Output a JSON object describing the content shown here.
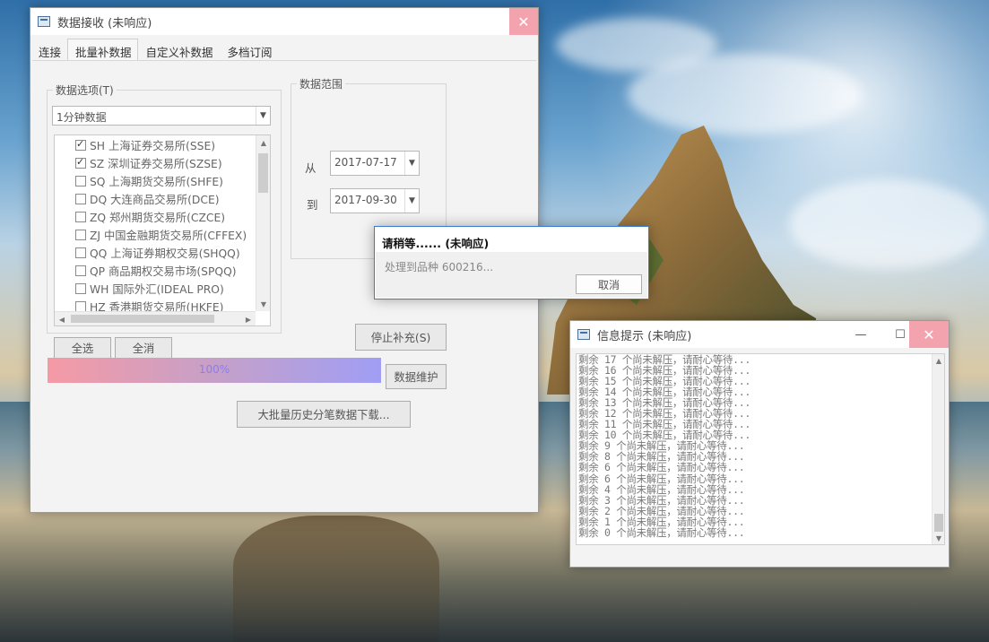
{
  "main_window": {
    "title": "数据接收 (未响应)",
    "close_symbol": "✕",
    "tabs": [
      "连接",
      "批量补数据",
      "自定义补数据",
      "多档订阅"
    ],
    "data_options_label": "数据选项(T)",
    "data_type_selected": "1分钟数据",
    "markets": [
      {
        "label": "SH 上海证券交易所(SSE)",
        "checked": true
      },
      {
        "label": "SZ 深圳证券交易所(SZSE)",
        "checked": true
      },
      {
        "label": "SQ 上海期货交易所(SHFE)",
        "checked": false
      },
      {
        "label": "DQ 大连商品交易所(DCE)",
        "checked": false
      },
      {
        "label": "ZQ 郑州期货交易所(CZCE)",
        "checked": false
      },
      {
        "label": "ZJ 中国金融期货交易所(CFFEX)",
        "checked": false
      },
      {
        "label": "QQ 上海证券期权交易(SHQQ)",
        "checked": false
      },
      {
        "label": "QP 商品期权交易市场(SPQQ)",
        "checked": false
      },
      {
        "label": "WH 国际外汇(IDEAL PRO)",
        "checked": false
      },
      {
        "label": "HZ 香港期货交易所(HKFE)",
        "checked": false
      }
    ],
    "range_label": "数据范围",
    "from_label": "从",
    "from_date": "2017-07-17",
    "to_label": "到",
    "to_date": "2017-09-30",
    "select_all": "全选",
    "select_none": "全消",
    "stop_button": "停止补充(S)",
    "progress_text": "100%",
    "progress_value": 1.0,
    "maintain_button": "数据维护",
    "bulk_download_button": "大批量历史分笔数据下载..."
  },
  "wait_dialog": {
    "title": "请稍等...... (未响应)",
    "message": "处理到品种 600216...",
    "cancel_button": "取消"
  },
  "info_window": {
    "title": "信息提示 (未响应)",
    "minimize_symbol": "—",
    "maximize_symbol": "☐",
    "close_symbol": "✕",
    "log_lines": [
      "剩余 17 个尚未解压，请耐心等待...",
      "剩余 16 个尚未解压，请耐心等待...",
      "剩余 15 个尚未解压，请耐心等待...",
      "剩余 14 个尚未解压，请耐心等待...",
      "剩余 13 个尚未解压，请耐心等待...",
      "剩余 12 个尚未解压，请耐心等待...",
      "剩余 11 个尚未解压，请耐心等待...",
      "剩余 10 个尚未解压，请耐心等待...",
      "剩余 9 个尚未解压，请耐心等待...",
      "剩余 8 个尚未解压，请耐心等待...",
      "剩余 6 个尚未解压，请耐心等待...",
      "剩余 6 个尚未解压，请耐心等待...",
      "剩余 4 个尚未解压，请耐心等待...",
      "剩余 3 个尚未解压，请耐心等待...",
      "剩余 2 个尚未解压，请耐心等待...",
      "剩余 1 个尚未解压，请耐心等待...",
      "剩余 0 个尚未解压，请耐心等待..."
    ]
  }
}
